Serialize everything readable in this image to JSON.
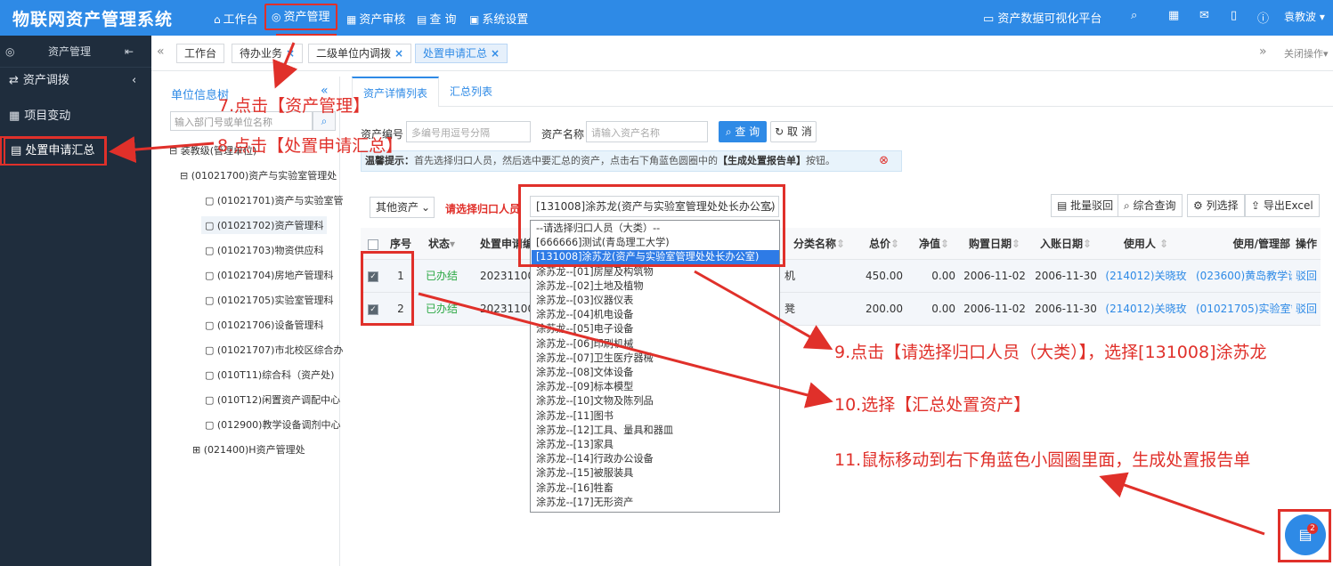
{
  "app_title": "物联网资产管理系统",
  "nav": {
    "workbench": "工作台",
    "asset_mgmt": "资产管理",
    "asset_audit": "资产审核",
    "query": "查 询",
    "settings": "系统设置"
  },
  "topbar_right": {
    "platform": "资产数据可视化平台",
    "user": "袁教波"
  },
  "sidebar": {
    "header": "资产管理",
    "items": [
      "资产调拨",
      "项目变动",
      "处置申请汇总"
    ]
  },
  "tabs": [
    "工作台",
    "待办业务",
    "二级单位内调拨",
    "处置申请汇总"
  ],
  "tabs_right": "关闭操作",
  "tree": {
    "title": "单位信息树",
    "search_placeholder": "输入部门号或单位名称",
    "nodes": [
      "装教级(管理单位)",
      "(01021700)资产与实验室管理处",
      "(01021701)资产与实验室管",
      "(01021702)资产管理科",
      "(01021703)物资供应科",
      "(01021704)房地产管理科",
      "(01021705)实验室管理科",
      "(01021706)设备管理科",
      "(01021707)市北校区综合办",
      "(010T11)综合科（资产处)",
      "(010T12)闲置资产调配中心",
      "(012900)教学设备调剂中心",
      "(021400)H资产管理处"
    ]
  },
  "subtabs": {
    "detail": "资产详情列表",
    "summary": "汇总列表"
  },
  "search": {
    "code_label": "资产编号",
    "code_placeholder": "多编号用逗号分隔",
    "name_label": "资产名称",
    "name_placeholder": "请输入资产名称",
    "query_btn": "查 询",
    "cancel_btn": "取 消"
  },
  "tip": {
    "prefix": "温馨提示：",
    "text": "首先选择归口人员，然后选中要汇总的资产，点击右下角蓝色圆圈中的",
    "bold": "【生成处置报告单】",
    "suffix": "按钮。"
  },
  "filter": {
    "category": "其他资产",
    "person_label": "请选择归口人员",
    "person_selected": "[131008]涂苏龙(资产与实验室管理处处长办公室)"
  },
  "toolbar": {
    "batch_reject": "批量驳回",
    "combined_query": "综合查询",
    "column_select": "列选择",
    "export": "导出Excel"
  },
  "table": {
    "headers": [
      "序号",
      "状态",
      "处置申请编",
      "分类名称",
      "总价",
      "净值",
      "购置日期",
      "入账日期",
      "使用人",
      "使用/管理部",
      "操作"
    ],
    "rows": [
      {
        "no": "1",
        "status": "已办结",
        "code": "2023110002",
        "cat": "机",
        "total": "450.00",
        "net": "0.00",
        "buy": "2006-11-02",
        "entry": "2006-11-30",
        "user": "(214012)关晓玫",
        "dept": "(023600)黄岛教学设",
        "op": "驳回"
      },
      {
        "no": "2",
        "status": "已办结",
        "code": "2023110002",
        "cat": "凳",
        "total": "200.00",
        "net": "0.00",
        "buy": "2006-11-02",
        "entry": "2006-11-30",
        "user": "(214012)关晓玫",
        "dept": "(01021705)实验室管",
        "op": "驳回"
      }
    ]
  },
  "dropdown": [
    "--请选择归口人员（大类）--",
    "[666666]测试(青岛理工大学)",
    "[131008]涂苏龙(资产与实验室管理处处长办公室)",
    "涂苏龙--[01]房屋及构筑物",
    "涂苏龙--[02]土地及植物",
    "涂苏龙--[03]仪器仪表",
    "涂苏龙--[04]机电设备",
    "涂苏龙--[05]电子设备",
    "涂苏龙--[06]印刷机械",
    "涂苏龙--[07]卫生医疗器械",
    "涂苏龙--[08]文体设备",
    "涂苏龙--[09]标本模型",
    "涂苏龙--[10]文物及陈列品",
    "涂苏龙--[11]图书",
    "涂苏龙--[12]工具、量具和器皿",
    "涂苏龙--[13]家具",
    "涂苏龙--[14]行政办公设备",
    "涂苏龙--[15]被服装具",
    "涂苏龙--[16]牲畜",
    "涂苏龙--[17]无形资产"
  ],
  "annotations": {
    "a7": "7.点击【资产管理】",
    "a8": "8.点击【处置申请汇总】",
    "a9": "9.点击【请选择归口人员（大类）】，选择[131008]涂苏龙",
    "a10": "10.选择【汇总处置资产】",
    "a11": "11.鼠标移动到右下角蓝色小圆圈里面，生成处置报告单"
  },
  "fab_badge": "2",
  "colors": {
    "primary": "#2e8ae6",
    "sidebar": "#1f2d3d",
    "annotation": "#e0302a",
    "done": "#2aa843"
  }
}
